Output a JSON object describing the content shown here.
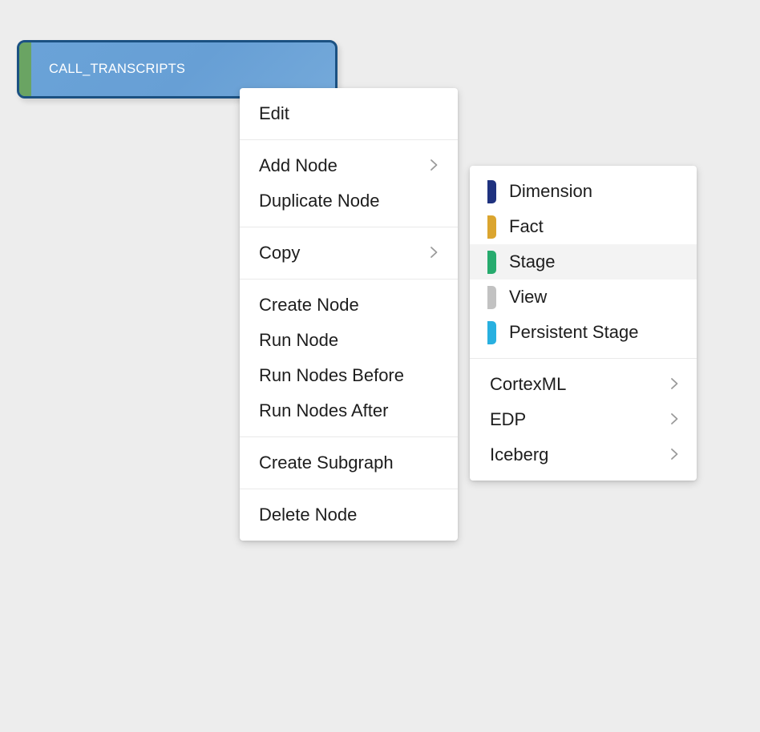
{
  "canvas": {
    "background_color": "#ededed",
    "node": {
      "label": "CALL_TRANSCRIPTS",
      "fill_color": "#6aa3d8",
      "border_color": "#1b5182",
      "accent_color": "#6aa463",
      "text_color": "#ffffff"
    }
  },
  "context_menu": {
    "groups": [
      {
        "items": [
          {
            "label": "Edit",
            "has_submenu": false
          }
        ]
      },
      {
        "items": [
          {
            "label": "Add Node",
            "has_submenu": true,
            "chevron": "chevron-right-icon"
          },
          {
            "label": "Duplicate Node",
            "has_submenu": false
          }
        ]
      },
      {
        "items": [
          {
            "label": "Copy",
            "has_submenu": true,
            "chevron": "chevron-right-icon"
          }
        ]
      },
      {
        "items": [
          {
            "label": "Create Node",
            "has_submenu": false
          },
          {
            "label": "Run Node",
            "has_submenu": false
          },
          {
            "label": "Run Nodes Before",
            "has_submenu": false
          },
          {
            "label": "Run Nodes After",
            "has_submenu": false
          }
        ]
      },
      {
        "items": [
          {
            "label": "Create Subgraph",
            "has_submenu": false
          }
        ]
      },
      {
        "items": [
          {
            "label": "Delete Node",
            "has_submenu": false
          }
        ]
      }
    ]
  },
  "add_node_submenu": {
    "groups": [
      {
        "items": [
          {
            "label": "Dimension",
            "swatch_color": "#1f327f",
            "highlighted": false,
            "has_submenu": false
          },
          {
            "label": "Fact",
            "swatch_color": "#dba52f",
            "highlighted": false,
            "has_submenu": false
          },
          {
            "label": "Stage",
            "swatch_color": "#27ab6e",
            "highlighted": true,
            "has_submenu": false
          },
          {
            "label": "View",
            "swatch_color": "#c2c2c2",
            "highlighted": false,
            "has_submenu": false
          },
          {
            "label": "Persistent Stage",
            "swatch_color": "#28b0e0",
            "highlighted": false,
            "has_submenu": false
          }
        ]
      },
      {
        "items": [
          {
            "label": "CortexML",
            "has_submenu": true,
            "chevron": "chevron-right-icon"
          },
          {
            "label": "EDP",
            "has_submenu": true,
            "chevron": "chevron-right-icon"
          },
          {
            "label": "Iceberg",
            "has_submenu": true,
            "chevron": "chevron-right-icon"
          }
        ]
      }
    ]
  }
}
